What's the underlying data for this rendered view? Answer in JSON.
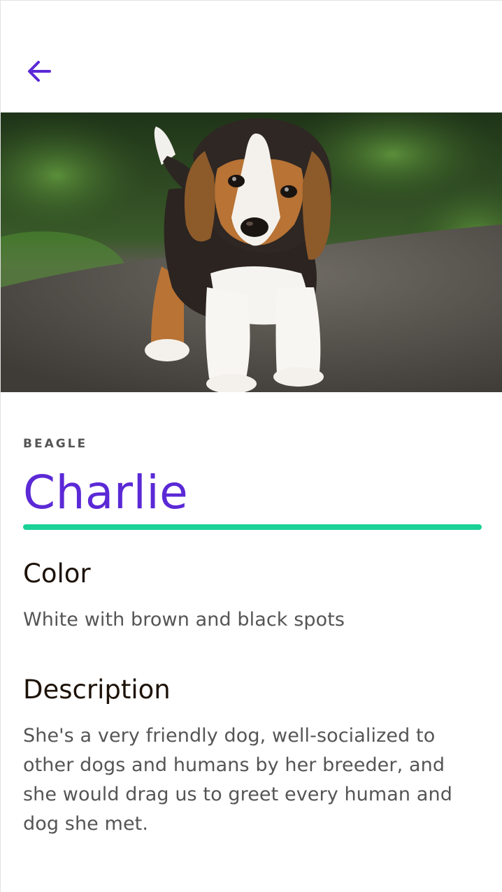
{
  "app_bar": {
    "back_icon": "arrow-left-icon",
    "accent_color": "#5b29d6"
  },
  "hero": {
    "image": "beagle-puppy-photo"
  },
  "dog": {
    "breed": "BEAGLE",
    "name": "Charlie",
    "underline_color": "#1ad197"
  },
  "sections": {
    "color": {
      "title": "Color",
      "text": "White with brown and black spots"
    },
    "description": {
      "title": "Description",
      "text": "She's a very friendly dog, well-socialized to other dogs and humans by her breeder, and she would drag us to greet every human and dog she met."
    }
  }
}
